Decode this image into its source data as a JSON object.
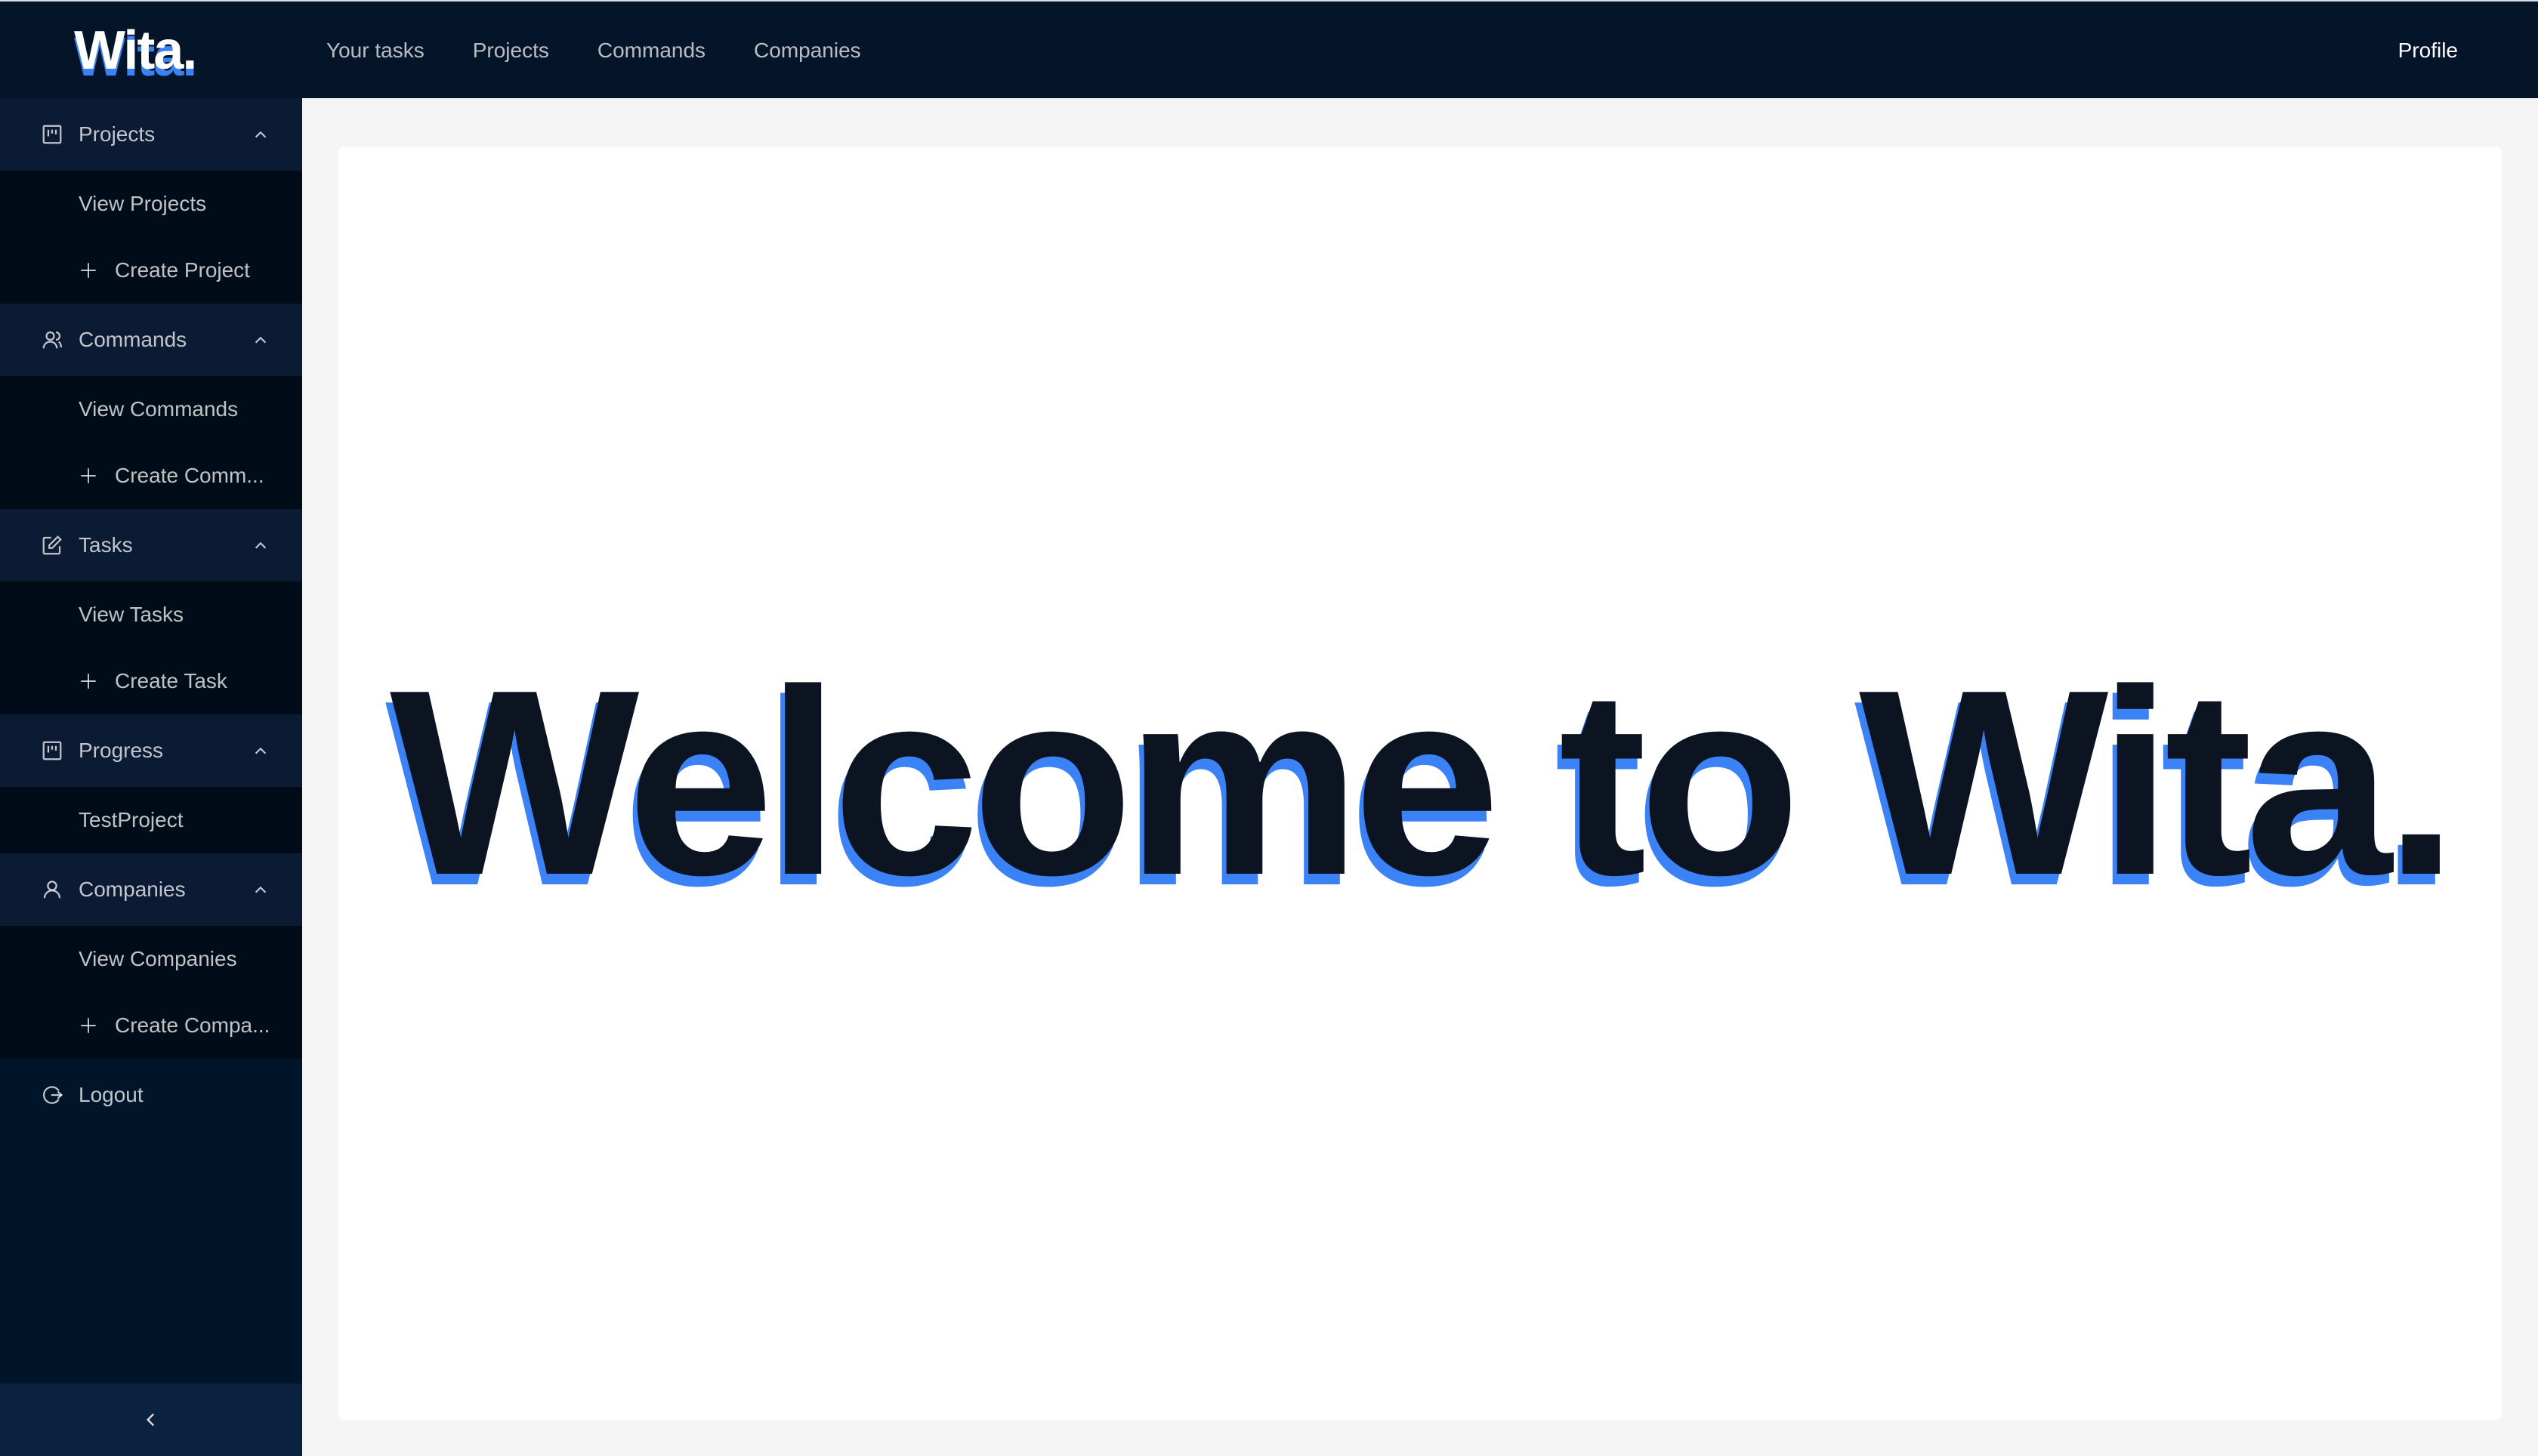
{
  "app": {
    "logo": "Wita.",
    "brand_accent": "#3b82f6",
    "dark_bg": "#001529"
  },
  "topnav": {
    "items": [
      "Your tasks",
      "Projects",
      "Commands",
      "Companies"
    ],
    "profile": "Profile"
  },
  "sidebar": {
    "groups": [
      {
        "label": "Projects",
        "icon": "project-board-icon",
        "expanded": true,
        "items": [
          {
            "label": "View Projects",
            "icon": null
          },
          {
            "label": "Create Project",
            "icon": "plus-icon"
          }
        ]
      },
      {
        "label": "Commands",
        "icon": "team-icon",
        "expanded": true,
        "items": [
          {
            "label": "View Commands",
            "icon": null
          },
          {
            "label": "Create Comm...",
            "icon": "plus-icon"
          }
        ]
      },
      {
        "label": "Tasks",
        "icon": "edit-icon",
        "expanded": true,
        "items": [
          {
            "label": "View Tasks",
            "icon": null
          },
          {
            "label": "Create Task",
            "icon": "plus-icon"
          }
        ]
      },
      {
        "label": "Progress",
        "icon": "project-board-icon",
        "expanded": true,
        "items": [
          {
            "label": "TestProject",
            "icon": null
          }
        ]
      },
      {
        "label": "Companies",
        "icon": "user-icon",
        "expanded": true,
        "items": [
          {
            "label": "View Companies",
            "icon": null
          },
          {
            "label": "Create Compa...",
            "icon": "plus-icon"
          }
        ]
      }
    ],
    "logout": "Logout",
    "collapse_icon": "chevron-left-icon"
  },
  "main": {
    "welcome": "Welcome to Wita."
  }
}
